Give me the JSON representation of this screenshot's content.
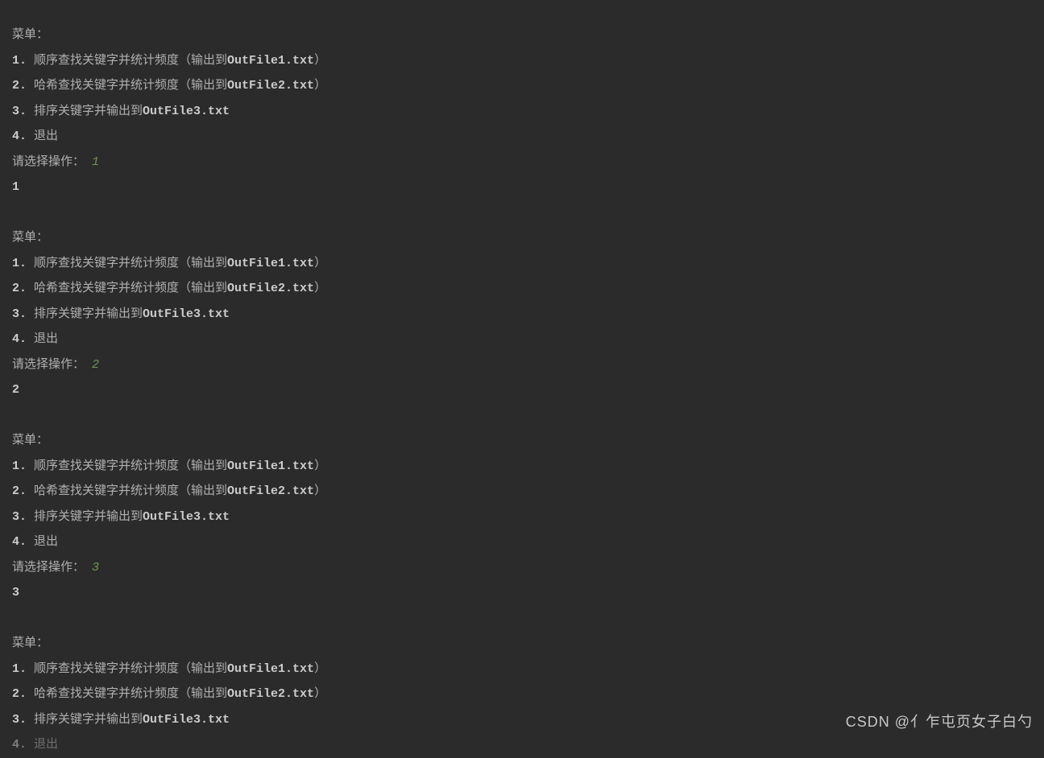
{
  "menu": {
    "title": "菜单：",
    "items": [
      {
        "num": "1.",
        "prefix": " 顺序查找关键字并统计频度（输出到",
        "filename": "OutFile1.txt",
        "suffix": "）"
      },
      {
        "num": "2.",
        "prefix": " 哈希查找关键字并统计频度（输出到",
        "filename": "OutFile2.txt",
        "suffix": "）"
      },
      {
        "num": "3.",
        "prefix": " 排序关键字并输出到",
        "filename": "OutFile3.txt",
        "suffix": ""
      },
      {
        "num": "4.",
        "prefix": " 退出",
        "filename": "",
        "suffix": ""
      }
    ],
    "prompt": "请选择操作："
  },
  "sessions": [
    {
      "choice": " 1",
      "echo": "1"
    },
    {
      "choice": " 2",
      "echo": "2"
    },
    {
      "choice": " 3",
      "echo": "3"
    }
  ],
  "partial_menu_lines": 3,
  "partial_item4_num": "4.",
  "partial_item4_text": " 退出",
  "watermark": "CSDN @亻乍屯页女子白勺"
}
